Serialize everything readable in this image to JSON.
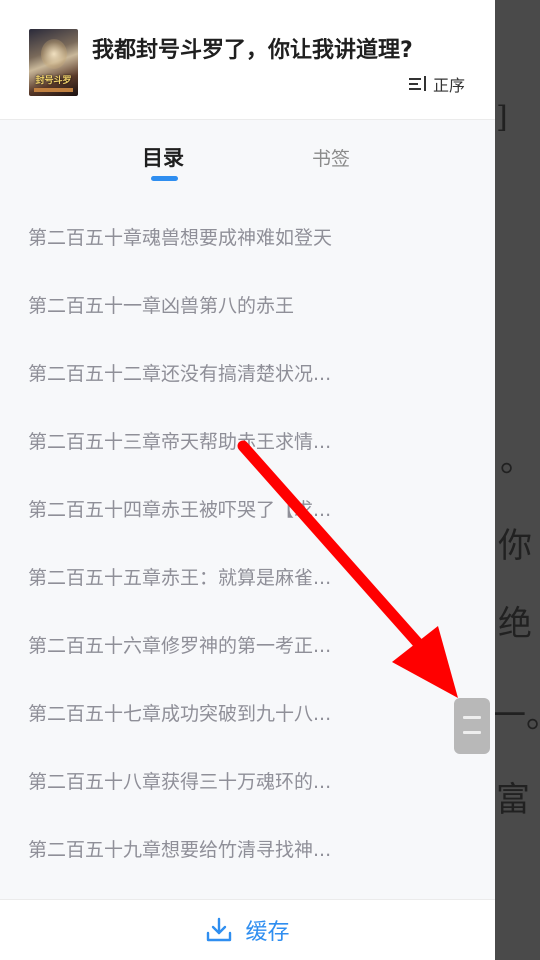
{
  "book": {
    "title": "我都封号斗罗了，你让我讲道理?",
    "cover_text": "封号斗罗"
  },
  "sort": {
    "label": "正序",
    "icon": "sort-icon"
  },
  "tabs": [
    {
      "label": "目录",
      "active": true
    },
    {
      "label": "书签",
      "active": false
    }
  ],
  "chapters": [
    "第二百五十章魂兽想要成神难如登天",
    "第二百五十一章凶兽第八的赤王",
    "第二百五十二章还没有搞清楚状况...",
    "第二百五十三章帝天帮助赤王求情...",
    "第二百五十四章赤王被吓哭了【求...",
    "第二百五十五章赤王：就算是麻雀...",
    "第二百五十六章修罗神的第一考正...",
    "第二百五十七章成功突破到九十八...",
    "第二百五十八章获得三十万魂环的...",
    "第二百五十九章想要给竹清寻找神..."
  ],
  "footer": {
    "cache_label": "缓存",
    "cache_icon": "download-icon"
  },
  "background_text": [
    "。",
    "你",
    "绝",
    "一。",
    "富",
    "]"
  ],
  "colors": {
    "accent": "#2f8ef0",
    "annotation": "#ff0000",
    "chapter_text": "#8f8f98"
  }
}
